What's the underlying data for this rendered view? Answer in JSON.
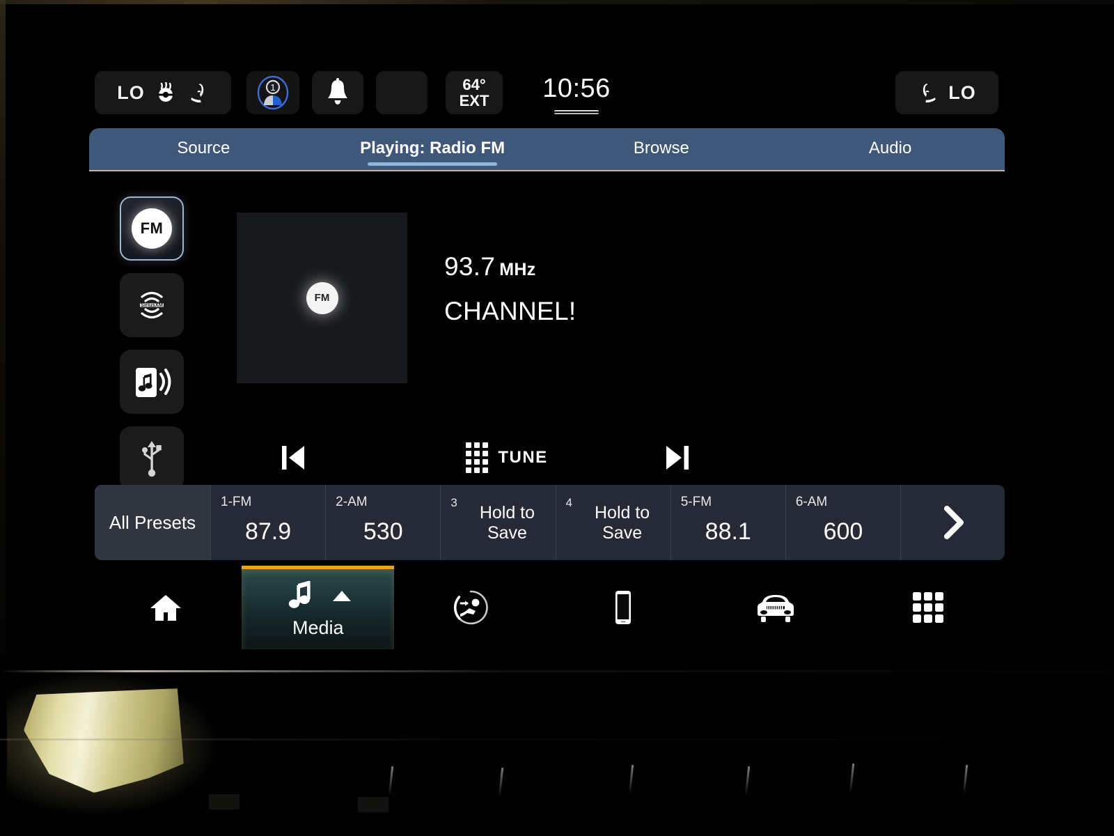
{
  "statusbar": {
    "left_climate": {
      "temp_label": "LO",
      "icons": [
        "heated-steering-wheel-icon",
        "heated-seat-icon"
      ]
    },
    "profile": {
      "icon": "driver-profile-1-icon",
      "number": "1"
    },
    "notifications": {
      "icon": "bell-icon"
    },
    "blank_chip": {
      "label": ""
    },
    "exterior_temp": {
      "value": "64°",
      "label": "EXT"
    },
    "clock": "10:56",
    "right_climate": {
      "temp_label": "LO",
      "icon": "heated-seat-icon"
    },
    "drag_handle": "status-drawer-handle"
  },
  "tabs": [
    {
      "label": "Source",
      "active": false
    },
    {
      "label": "Playing: Radio FM",
      "active": true
    },
    {
      "label": "Browse",
      "active": false
    },
    {
      "label": "Audio",
      "active": false
    }
  ],
  "source_rail": [
    {
      "name": "fm",
      "label": "FM",
      "icon": "fm-radio-icon",
      "selected": true
    },
    {
      "name": "siriusxm",
      "label": "SiriusXM",
      "icon": "siriusxm-icon",
      "selected": false
    },
    {
      "name": "bluetooth-audio",
      "label": "Bluetooth Audio",
      "icon": "bluetooth-audio-icon",
      "selected": false
    },
    {
      "name": "usb",
      "label": "USB",
      "icon": "usb-icon",
      "selected": false
    }
  ],
  "now_playing": {
    "artwork_badge": "FM",
    "frequency": "93.7",
    "frequency_unit": "MHz",
    "station_text": "CHANNEL!"
  },
  "transport": {
    "prev_label": "Previous",
    "prev_icon": "skip-previous-icon",
    "tune_label": "TUNE",
    "tune_icon": "keypad-grid-icon",
    "next_label": "Next",
    "next_icon": "skip-next-icon"
  },
  "presets": {
    "all_label": "All Presets",
    "next_icon": "chevron-right-icon",
    "items": [
      {
        "slot": "1-FM",
        "value": "87.9",
        "empty": false
      },
      {
        "slot": "2-AM",
        "value": "530",
        "empty": false
      },
      {
        "slot": "3",
        "value": "Hold to Save",
        "empty": true
      },
      {
        "slot": "4",
        "value": "Hold to Save",
        "empty": true
      },
      {
        "slot": "5-FM",
        "value": "88.1",
        "empty": false
      },
      {
        "slot": "6-AM",
        "value": "600",
        "empty": false
      }
    ]
  },
  "bottom_nav": [
    {
      "label": "",
      "icon": "home-icon",
      "active": false
    },
    {
      "label": "Media",
      "icon": "music-note-icon",
      "active": true
    },
    {
      "label": "",
      "icon": "climate-comfort-icon",
      "active": false
    },
    {
      "label": "",
      "icon": "phone-icon",
      "active": false
    },
    {
      "label": "",
      "icon": "vehicle-icon",
      "active": false
    },
    {
      "label": "",
      "icon": "apps-grid-icon",
      "active": false
    }
  ],
  "colors": {
    "tabbar_blue": "#3f587a",
    "tab_underline": "#8fb4dd",
    "preset_bar": "#252a36",
    "media_accent": "#f0a21e",
    "screen_black": "#000000"
  }
}
